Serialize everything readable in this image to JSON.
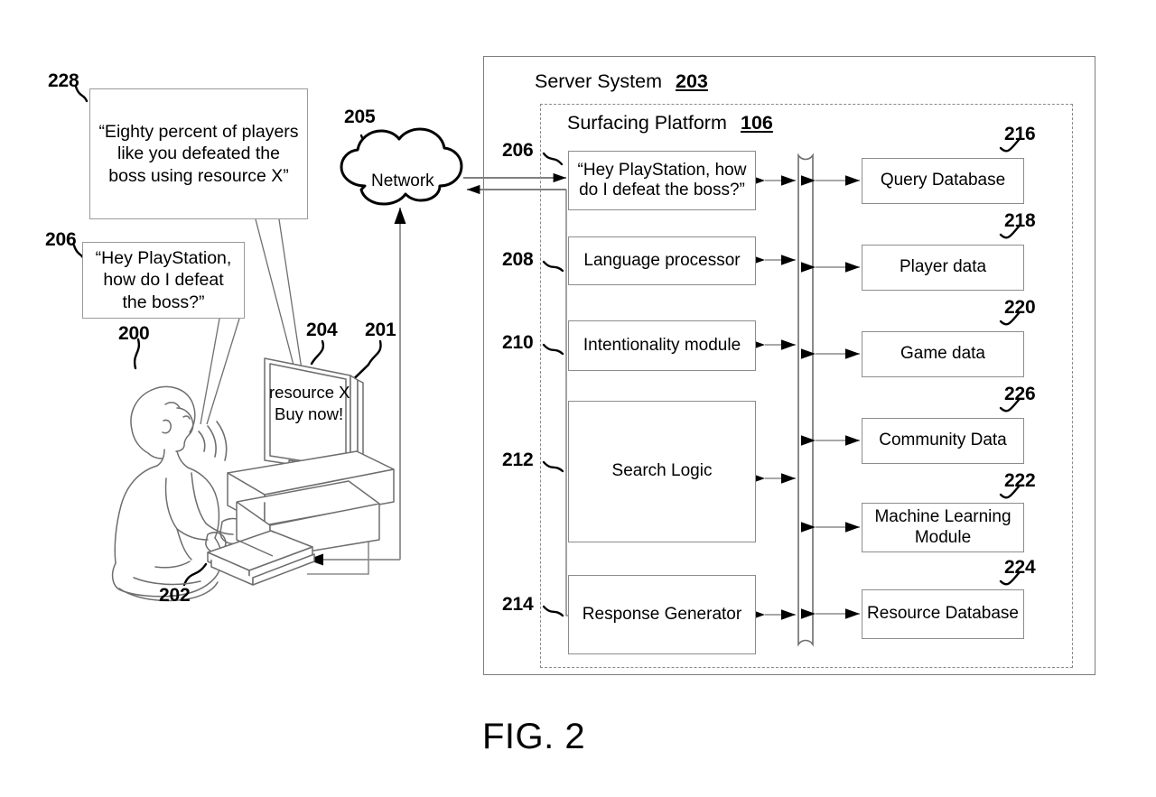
{
  "figure": {
    "caption": "FIG. 2"
  },
  "user_side": {
    "response_bubble": {
      "ref": "228",
      "text": "“Eighty percent of players like you defeated the boss using resource X”"
    },
    "query_bubble": {
      "ref": "206",
      "text": "“Hey PlayStation, how do I defeat the boss?”"
    },
    "player": {
      "ref": "200",
      "name": "player-illustration"
    },
    "console": {
      "ref": "202",
      "name": "game-console-illustration"
    },
    "display": {
      "ref": "201",
      "name": "television-display"
    },
    "display_content_ref": {
      "ref": "204"
    },
    "display_text_line1": "resource X",
    "display_text_line2": "Buy now!"
  },
  "network": {
    "ref": "205",
    "label": "Network"
  },
  "server": {
    "title": "Server System",
    "ref": "203",
    "platform": {
      "title": "Surfacing Platform",
      "ref": "106"
    },
    "left_modules": [
      {
        "ref": "206",
        "label": "“Hey PlayStation, how do I defeat the boss?”"
      },
      {
        "ref": "208",
        "label": "Language processor"
      },
      {
        "ref": "210",
        "label": "Intentionality module"
      },
      {
        "ref": "212",
        "label": "Search Logic"
      },
      {
        "ref": "214",
        "label": "Response Generator"
      }
    ],
    "right_modules": [
      {
        "ref": "216",
        "label": "Query Database"
      },
      {
        "ref": "218",
        "label": "Player data"
      },
      {
        "ref": "220",
        "label": "Game data"
      },
      {
        "ref": "226",
        "label": "Community Data"
      },
      {
        "ref": "222",
        "label": "Machine Learning Module"
      },
      {
        "ref": "224",
        "label": "Resource Database"
      }
    ],
    "bus": {
      "name": "system-bus"
    }
  },
  "colors": {
    "line": "#8c8c8c",
    "ink": "#000000",
    "paper": "#ffffff"
  }
}
